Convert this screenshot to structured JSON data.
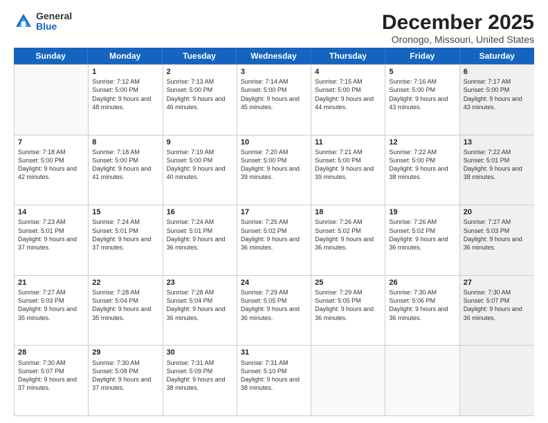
{
  "logo": {
    "general": "General",
    "blue": "Blue"
  },
  "title": "December 2025",
  "location": "Oronogo, Missouri, United States",
  "days_of_week": [
    "Sunday",
    "Monday",
    "Tuesday",
    "Wednesday",
    "Thursday",
    "Friday",
    "Saturday"
  ],
  "weeks": [
    [
      {
        "day": "",
        "empty": true,
        "shaded": false,
        "sunrise": "",
        "sunset": "",
        "daylight": ""
      },
      {
        "day": "1",
        "empty": false,
        "shaded": false,
        "sunrise": "7:12 AM",
        "sunset": "5:00 PM",
        "daylight": "9 hours and 48 minutes."
      },
      {
        "day": "2",
        "empty": false,
        "shaded": false,
        "sunrise": "7:13 AM",
        "sunset": "5:00 PM",
        "daylight": "9 hours and 46 minutes."
      },
      {
        "day": "3",
        "empty": false,
        "shaded": false,
        "sunrise": "7:14 AM",
        "sunset": "5:00 PM",
        "daylight": "9 hours and 45 minutes."
      },
      {
        "day": "4",
        "empty": false,
        "shaded": false,
        "sunrise": "7:15 AM",
        "sunset": "5:00 PM",
        "daylight": "9 hours and 44 minutes."
      },
      {
        "day": "5",
        "empty": false,
        "shaded": false,
        "sunrise": "7:16 AM",
        "sunset": "5:00 PM",
        "daylight": "9 hours and 43 minutes."
      },
      {
        "day": "6",
        "empty": false,
        "shaded": true,
        "sunrise": "7:17 AM",
        "sunset": "5:00 PM",
        "daylight": "9 hours and 43 minutes."
      }
    ],
    [
      {
        "day": "7",
        "empty": false,
        "shaded": false,
        "sunrise": "7:18 AM",
        "sunset": "5:00 PM",
        "daylight": "9 hours and 42 minutes."
      },
      {
        "day": "8",
        "empty": false,
        "shaded": false,
        "sunrise": "7:18 AM",
        "sunset": "5:00 PM",
        "daylight": "9 hours and 41 minutes."
      },
      {
        "day": "9",
        "empty": false,
        "shaded": false,
        "sunrise": "7:19 AM",
        "sunset": "5:00 PM",
        "daylight": "9 hours and 40 minutes."
      },
      {
        "day": "10",
        "empty": false,
        "shaded": false,
        "sunrise": "7:20 AM",
        "sunset": "5:00 PM",
        "daylight": "9 hours and 39 minutes."
      },
      {
        "day": "11",
        "empty": false,
        "shaded": false,
        "sunrise": "7:21 AM",
        "sunset": "5:00 PM",
        "daylight": "9 hours and 39 minutes."
      },
      {
        "day": "12",
        "empty": false,
        "shaded": false,
        "sunrise": "7:22 AM",
        "sunset": "5:00 PM",
        "daylight": "9 hours and 38 minutes."
      },
      {
        "day": "13",
        "empty": false,
        "shaded": true,
        "sunrise": "7:22 AM",
        "sunset": "5:01 PM",
        "daylight": "9 hours and 38 minutes."
      }
    ],
    [
      {
        "day": "14",
        "empty": false,
        "shaded": false,
        "sunrise": "7:23 AM",
        "sunset": "5:01 PM",
        "daylight": "9 hours and 37 minutes."
      },
      {
        "day": "15",
        "empty": false,
        "shaded": false,
        "sunrise": "7:24 AM",
        "sunset": "5:01 PM",
        "daylight": "9 hours and 37 minutes."
      },
      {
        "day": "16",
        "empty": false,
        "shaded": false,
        "sunrise": "7:24 AM",
        "sunset": "5:01 PM",
        "daylight": "9 hours and 36 minutes."
      },
      {
        "day": "17",
        "empty": false,
        "shaded": false,
        "sunrise": "7:25 AM",
        "sunset": "5:02 PM",
        "daylight": "9 hours and 36 minutes."
      },
      {
        "day": "18",
        "empty": false,
        "shaded": false,
        "sunrise": "7:26 AM",
        "sunset": "5:02 PM",
        "daylight": "9 hours and 36 minutes."
      },
      {
        "day": "19",
        "empty": false,
        "shaded": false,
        "sunrise": "7:26 AM",
        "sunset": "5:02 PM",
        "daylight": "9 hours and 36 minutes."
      },
      {
        "day": "20",
        "empty": false,
        "shaded": true,
        "sunrise": "7:27 AM",
        "sunset": "5:03 PM",
        "daylight": "9 hours and 36 minutes."
      }
    ],
    [
      {
        "day": "21",
        "empty": false,
        "shaded": false,
        "sunrise": "7:27 AM",
        "sunset": "5:03 PM",
        "daylight": "9 hours and 35 minutes."
      },
      {
        "day": "22",
        "empty": false,
        "shaded": false,
        "sunrise": "7:28 AM",
        "sunset": "5:04 PM",
        "daylight": "9 hours and 35 minutes."
      },
      {
        "day": "23",
        "empty": false,
        "shaded": false,
        "sunrise": "7:28 AM",
        "sunset": "5:04 PM",
        "daylight": "9 hours and 36 minutes."
      },
      {
        "day": "24",
        "empty": false,
        "shaded": false,
        "sunrise": "7:29 AM",
        "sunset": "5:05 PM",
        "daylight": "9 hours and 36 minutes."
      },
      {
        "day": "25",
        "empty": false,
        "shaded": false,
        "sunrise": "7:29 AM",
        "sunset": "5:05 PM",
        "daylight": "9 hours and 36 minutes."
      },
      {
        "day": "26",
        "empty": false,
        "shaded": false,
        "sunrise": "7:30 AM",
        "sunset": "5:06 PM",
        "daylight": "9 hours and 36 minutes."
      },
      {
        "day": "27",
        "empty": false,
        "shaded": true,
        "sunrise": "7:30 AM",
        "sunset": "5:07 PM",
        "daylight": "9 hours and 36 minutes."
      }
    ],
    [
      {
        "day": "28",
        "empty": false,
        "shaded": false,
        "sunrise": "7:30 AM",
        "sunset": "5:07 PM",
        "daylight": "9 hours and 37 minutes."
      },
      {
        "day": "29",
        "empty": false,
        "shaded": false,
        "sunrise": "7:30 AM",
        "sunset": "5:08 PM",
        "daylight": "9 hours and 37 minutes."
      },
      {
        "day": "30",
        "empty": false,
        "shaded": false,
        "sunrise": "7:31 AM",
        "sunset": "5:09 PM",
        "daylight": "9 hours and 38 minutes."
      },
      {
        "day": "31",
        "empty": false,
        "shaded": false,
        "sunrise": "7:31 AM",
        "sunset": "5:10 PM",
        "daylight": "9 hours and 38 minutes."
      },
      {
        "day": "",
        "empty": true,
        "shaded": false,
        "sunrise": "",
        "sunset": "",
        "daylight": ""
      },
      {
        "day": "",
        "empty": true,
        "shaded": false,
        "sunrise": "",
        "sunset": "",
        "daylight": ""
      },
      {
        "day": "",
        "empty": true,
        "shaded": true,
        "sunrise": "",
        "sunset": "",
        "daylight": ""
      }
    ]
  ]
}
